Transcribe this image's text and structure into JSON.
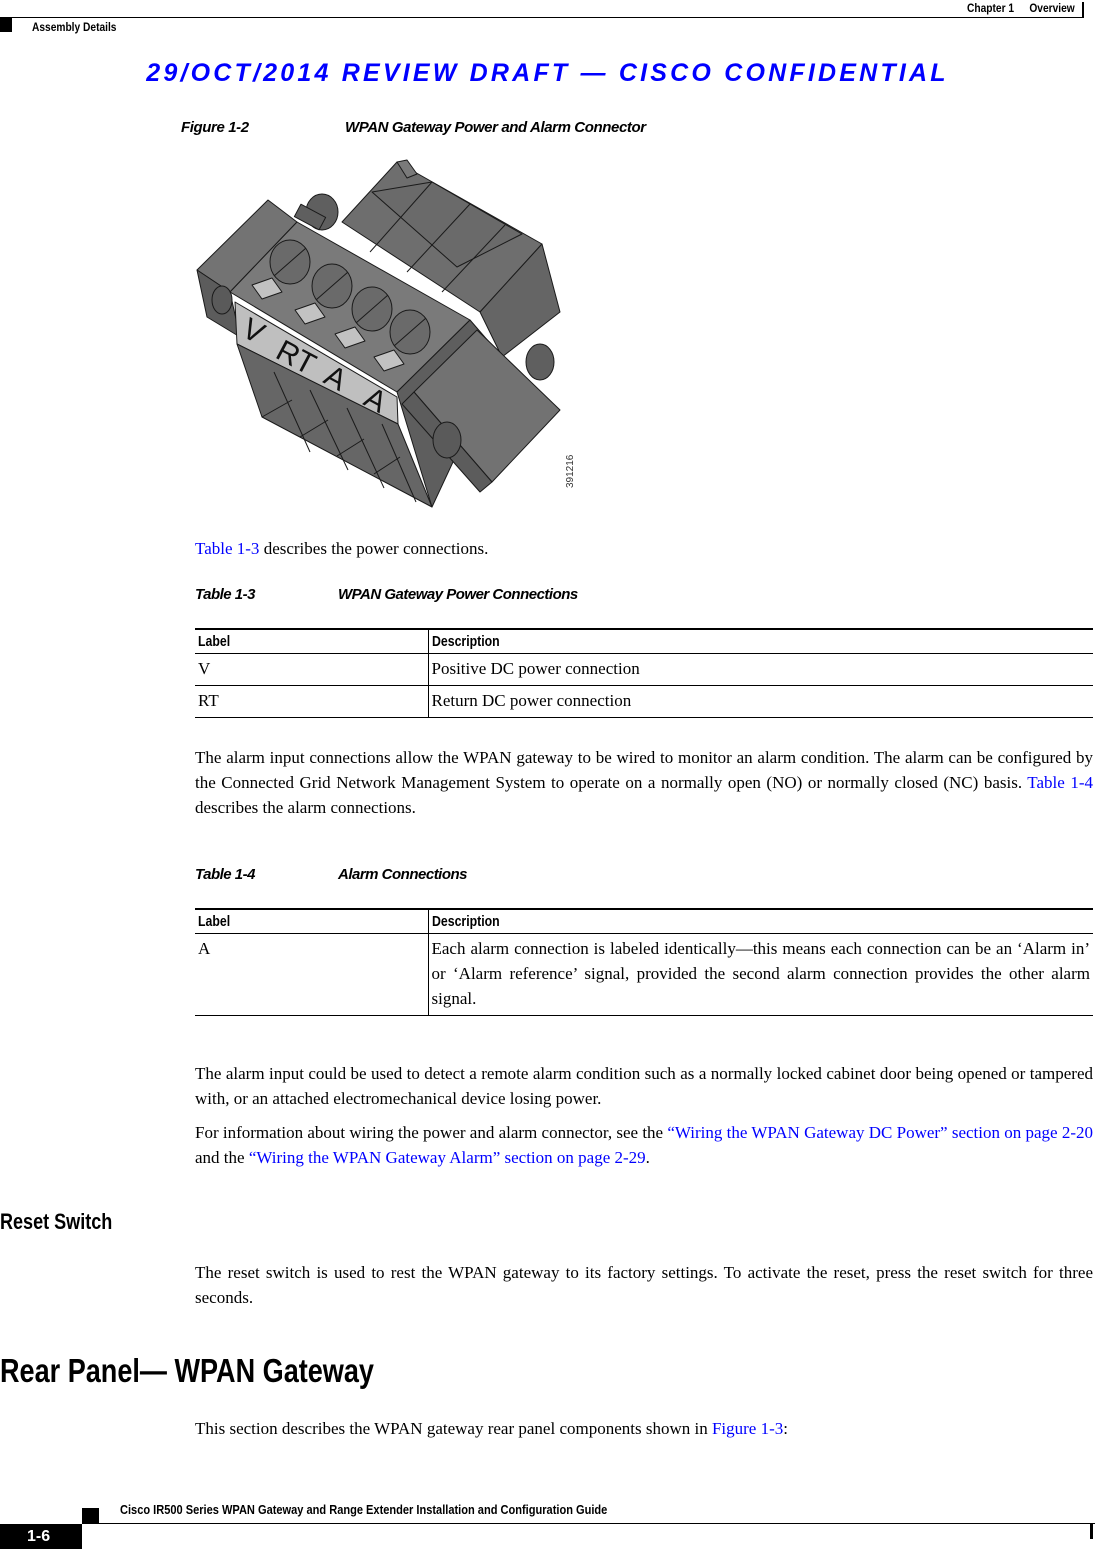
{
  "header": {
    "chapter_label": "Chapter 1",
    "chapter_title": "Overview",
    "section": "Assembly Details",
    "draft_banner": "29/OCT/2014 REVIEW DRAFT — CISCO CONFIDENTIAL"
  },
  "figure": {
    "number": "Figure 1-2",
    "title": "WPAN Gateway Power and Alarm Connector",
    "id": "391216",
    "connector_labels": [
      "V",
      "RT",
      "A",
      "A"
    ],
    "colors": {
      "body": "#6e6e6e",
      "label_strip": "#bfbfbf",
      "outline": "#1a1a1a"
    }
  },
  "intro_paragraph": {
    "link": "Table 1-3",
    "text": " describes the power connections."
  },
  "table_power": {
    "number": "Table 1-3",
    "title": "WPAN Gateway Power Connections",
    "headers": [
      "Label",
      "Description"
    ],
    "rows": [
      [
        "V",
        "Positive DC power connection"
      ],
      [
        "RT",
        "Return DC power connection"
      ]
    ]
  },
  "alarm_paragraph": {
    "text_before": "The alarm input connections allow the WPAN gateway to be wired to monitor an alarm condition. The alarm can be configured by the Connected Grid Network Management System to operate on a normally open (NO) or normally closed (NC) basis. ",
    "link": "Table 1-4",
    "text_after": " describes the alarm connections."
  },
  "table_alarm": {
    "number": "Table 1-4",
    "title": "Alarm Connections",
    "headers": [
      "Label",
      "Description"
    ],
    "rows": [
      [
        "A",
        "Each alarm connection is labeled identically—this means each connection can be an ‘Alarm in’ or ‘Alarm reference’ signal, provided the second alarm connection provides the other alarm signal."
      ]
    ]
  },
  "alarm_use_paragraph": "The alarm input could be used to detect a remote alarm condition such as a normally locked cabinet door being opened or tampered with, or an attached electromechanical device losing power.",
  "wiring_paragraph": {
    "text1": "For information about wiring the power and alarm connector, see the ",
    "link1": "“Wiring the WPAN Gateway DC Power” section on page 2-20",
    "text2": " and the ",
    "link2": "“Wiring the WPAN Gateway Alarm” section on page 2-29",
    "text3": "."
  },
  "reset_section": {
    "heading": "Reset Switch",
    "text": "The reset switch is used to rest the WPAN gateway to its factory settings. To activate the reset, press the reset switch for three seconds."
  },
  "rear_section": {
    "heading": "Rear Panel— WPAN Gateway",
    "text_before": "This section describes the WPAN gateway rear panel components shown in ",
    "link": "Figure 1-3",
    "text_after": ":"
  },
  "footer": {
    "guide_title": "Cisco IR500 Series WPAN Gateway and Range Extender Installation and Configuration Guide",
    "page_number": "1-6"
  }
}
